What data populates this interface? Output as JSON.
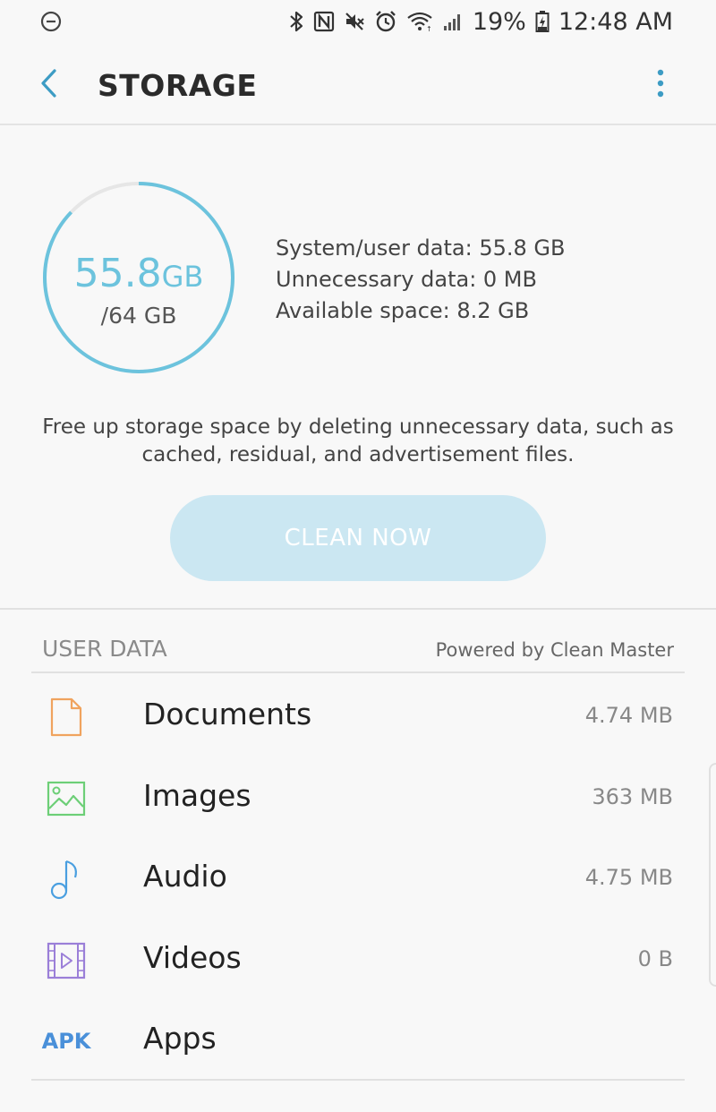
{
  "status_bar": {
    "battery": "19%",
    "time": "12:48 AM",
    "icons": [
      "do-not-disturb-icon",
      "bluetooth-icon",
      "nfc-icon",
      "mute-icon",
      "alarm-icon",
      "wifi-icon",
      "signal-icon",
      "battery-charging-icon"
    ]
  },
  "header": {
    "title": "STORAGE",
    "back_icon": "chevron-left-icon",
    "more_icon": "more-vert-icon"
  },
  "summary": {
    "used_value": "55.8",
    "used_unit": "GB",
    "total": "/64 GB",
    "used_fraction": 0.872,
    "stats": [
      "System/user data: 55.8 GB",
      "Unnecessary data: 0 MB",
      "Available space: 8.2 GB"
    ],
    "description": "Free up storage space by deleting unnecessary data, such as cached, residual, and advertisement files.",
    "clean_button": "CLEAN NOW"
  },
  "user_data": {
    "title": "USER DATA",
    "powered_by": "Powered by Clean Master",
    "items": [
      {
        "label": "Documents",
        "size": "4.74 MB",
        "icon": "document-icon"
      },
      {
        "label": "Images",
        "size": "363 MB",
        "icon": "image-icon"
      },
      {
        "label": "Audio",
        "size": "4.75 MB",
        "icon": "music-note-icon"
      },
      {
        "label": "Videos",
        "size": "0 B",
        "icon": "video-icon"
      },
      {
        "label": "Apps",
        "size": "",
        "icon": "apk-icon",
        "icon_text": "APK"
      }
    ]
  },
  "colors": {
    "accent": "#6cc3dd",
    "button_bg": "#cbe7f2",
    "document_icon": "#f0a35e",
    "image_icon": "#6dcf77",
    "audio_icon": "#4a9fe0",
    "video_icon": "#9b7fd8",
    "apk_icon": "#4a90d9"
  }
}
